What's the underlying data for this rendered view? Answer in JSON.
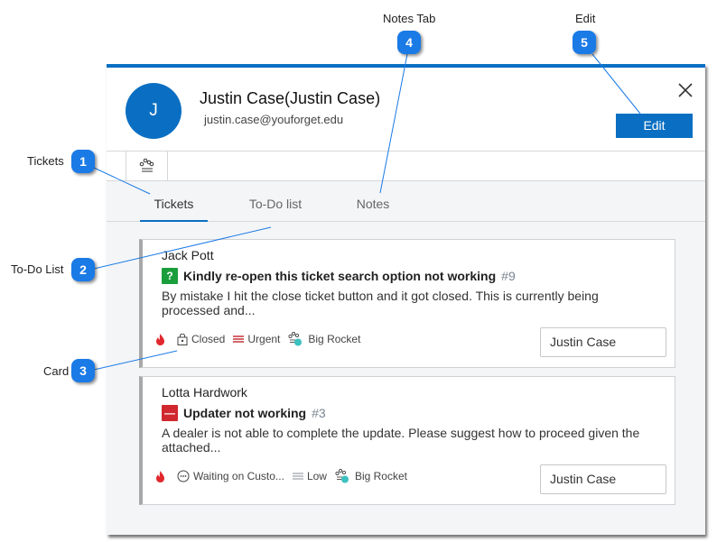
{
  "annotations": [
    {
      "number": "1",
      "label": "Tickets"
    },
    {
      "number": "2",
      "label": "To-Do List"
    },
    {
      "number": "3",
      "label": "Card"
    },
    {
      "number": "4",
      "label": "Notes Tab"
    },
    {
      "number": "5",
      "label": "Edit"
    }
  ],
  "header": {
    "avatar_initial": "J",
    "name": "Justin Case(Justin Case)",
    "email": "justin.case@youforget.edu",
    "edit_label": "Edit",
    "close_icon": "close-icon"
  },
  "toolbar": {
    "icon": "workflow-icon"
  },
  "tabs": [
    {
      "label": "Tickets",
      "active": true
    },
    {
      "label": "To-Do list",
      "active": false
    },
    {
      "label": "Notes",
      "active": false
    }
  ],
  "tickets": [
    {
      "requester": "Jack Pott",
      "status_icon": "?",
      "status_color": "#1a9e3c",
      "title": "Kindly re-open this ticket search option not working",
      "number": "#9",
      "description": "By mistake I hit the close ticket button and it got closed. This is currently being processed and...",
      "status": "Closed",
      "priority": "Urgent",
      "priority_color": "#c0272d",
      "workflow": "Big Rocket",
      "assignee": "Justin Case"
    },
    {
      "requester": "Lotta Hardwork",
      "status_icon": "—",
      "status_color": "#d0282e",
      "title": "Updater not working",
      "number": "#3",
      "description": "A dealer is not able to complete the update.  Please suggest how to proceed given the attached...",
      "status": "Waiting on Custo...",
      "priority": "Low",
      "priority_color": "#9aa0a6",
      "workflow": "Big Rocket",
      "assignee": "Justin Case"
    }
  ],
  "colors": {
    "accent": "#0a6fc2",
    "callout": "#1a7ae6",
    "flame": "#e0282e",
    "workflow_dot": "#3cc0c0"
  }
}
